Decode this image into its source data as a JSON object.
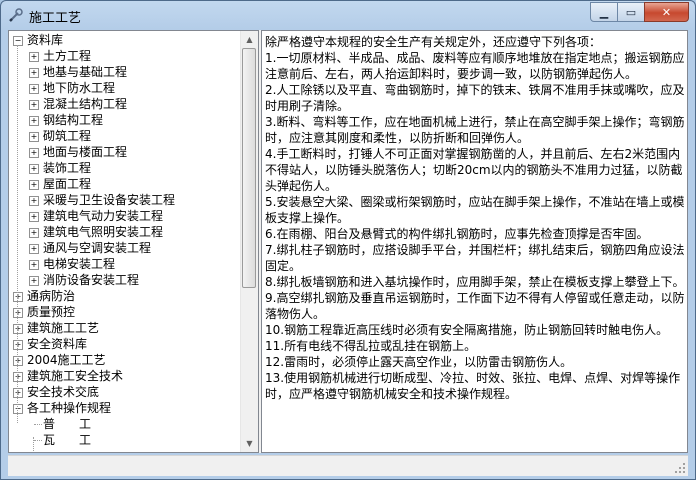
{
  "window": {
    "title": "施工工艺"
  },
  "tree": {
    "items": [
      {
        "label": "资料库",
        "expander": "−",
        "level": 0
      },
      {
        "label": "土方工程",
        "expander": "+",
        "level": 1
      },
      {
        "label": "地基与基础工程",
        "expander": "+",
        "level": 1
      },
      {
        "label": "地下防水工程",
        "expander": "+",
        "level": 1
      },
      {
        "label": "混凝土结构工程",
        "expander": "+",
        "level": 1
      },
      {
        "label": "钢结构工程",
        "expander": "+",
        "level": 1
      },
      {
        "label": "砌筑工程",
        "expander": "+",
        "level": 1
      },
      {
        "label": "地面与楼面工程",
        "expander": "+",
        "level": 1
      },
      {
        "label": "装饰工程",
        "expander": "+",
        "level": 1
      },
      {
        "label": "屋面工程",
        "expander": "+",
        "level": 1
      },
      {
        "label": "采暖与卫生设备安装工程",
        "expander": "+",
        "level": 1
      },
      {
        "label": "建筑电气动力安装工程",
        "expander": "+",
        "level": 1
      },
      {
        "label": "建筑电气照明安装工程",
        "expander": "+",
        "level": 1
      },
      {
        "label": "通风与空调安装工程",
        "expander": "+",
        "level": 1
      },
      {
        "label": "电梯安装工程",
        "expander": "+",
        "level": 1
      },
      {
        "label": "消防设备安装工程",
        "expander": "+",
        "level": 1
      },
      {
        "label": "通病防治",
        "expander": "+",
        "level": 0
      },
      {
        "label": "质量预控",
        "expander": "+",
        "level": 0
      },
      {
        "label": "建筑施工工艺",
        "expander": "+",
        "level": 0
      },
      {
        "label": "安全资料库",
        "expander": "+",
        "level": 0
      },
      {
        "label": "2004施工工艺",
        "expander": "+",
        "level": 0
      },
      {
        "label": "建筑施工安全技术",
        "expander": "+",
        "level": 0
      },
      {
        "label": "安全技术交底",
        "expander": "+",
        "level": 0
      },
      {
        "label": "各工种操作规程",
        "expander": "−",
        "level": 0
      },
      {
        "label": "普　　工",
        "expander": "",
        "level": 1
      },
      {
        "label": "瓦　　工",
        "expander": "",
        "level": 1
      }
    ]
  },
  "content": {
    "lines": [
      "除严格遵守本规程的安全生产有关规定外，还应遵守下列各项：",
      "1.一切原材料、半成品、成品、废料等应有顺序地堆放在指定地点；搬运钢筋应注意前后、左右，两人抬运卸料时，要步调一致，以防钢筋弹起伤人。",
      "2.人工除锈以及平直、弯曲钢筋时，掉下的铁末、铁屑不准用手抹或嘴吹，应及时用刷子清除。",
      "3.断料、弯料等工作，应在地面机械上进行，禁止在高空脚手架上操作；弯钢筋时，应注意其刚度和柔性，以防折断和回弹伤人。",
      "4.手工断料时，打锤人不可正面对掌握钢筋凿的人，并且前后、左右2米范围内不得站人，以防锤头脱落伤人；切断20cm以内的钢筋头不准用力过猛，以防截头弹起伤人。",
      "5.安装悬空大梁、圈梁或桁架钢筋时，应站在脚手架上操作，不准站在墙上或模板支撑上操作。",
      "6.在雨棚、阳台及悬臂式的构件绑扎钢筋时，应事先检查顶撑是否牢固。",
      "7.绑扎柱子钢筋时，应搭设脚手平台，并围栏杆；绑扎结束后，钢筋四角应设法固定。",
      "8.绑扎板墙钢筋和进入基坑操作时，应用脚手架，禁止在模板支撑上攀登上下。",
      "9.高空绑扎钢筋及垂直吊运钢筋时，工作面下边不得有人停留或任意走动，以防落物伤人。",
      "10.钢筋工程靠近高压线时必须有安全隔离措施，防止钢筋回转时触电伤人。",
      "11.所有电线不得乱拉或乱挂在钢筋上。",
      "12.雷雨时，必须停止露天高空作业，以防雷击钢筋伤人。",
      "13.使用钢筋机械进行切断成型、冷拉、时效、张拉、电焊、点焊、对焊等操作时，应严格遵守钢筋机械安全和技术操作规程。"
    ]
  },
  "scrollbar": {
    "position": 0.0,
    "visible_fraction": 0.62
  },
  "colors": {
    "title_bar": "#c2d8ef",
    "close_button": "#c7492f",
    "pane_border": "#828790"
  }
}
